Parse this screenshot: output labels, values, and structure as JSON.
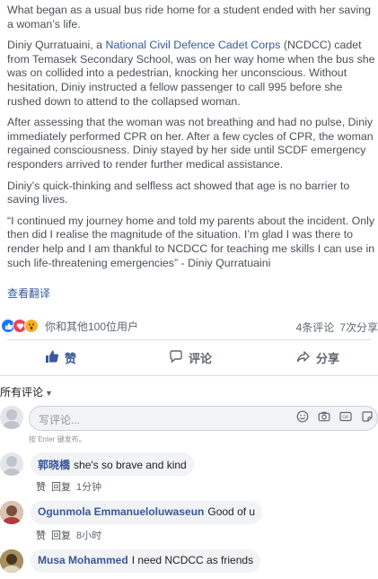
{
  "post": {
    "p1": "What began as a usual bus ride home for a student ended with her saving a woman’s life.",
    "p2_before": "Diniy Qurratuaini, a ",
    "p2_link": "National Civil Defence Cadet Corps",
    "p2_after": " (NCDCC) cadet from Temasek Secondary School, was on her way home when the bus she was on collided into a pedestrian, knocking her unconscious. Without hesitation, Diniy instructed a fellow passenger to call 995 before she rushed down to attend to the collapsed woman.",
    "p3": "After assessing that the woman was not breathing and had no pulse, Diniy immediately performed CPR on her. After a few cycles of CPR, the woman regained consciousness. Diniy stayed by her side until SCDF emergency responders arrived to render further medical assistance.",
    "p4": "Diniy’s quick-thinking and selfless act showed that age is no barrier to saving lives.",
    "p5": "“I continued my journey home and told my parents about the incident. Only then did I realise the magnitude of the situation. I’m glad I was there to render help and I am thankful to NCDCC for teaching me skills I can use in such life-threatening emergencies” - Diniy Qurratuaini",
    "translate": "查看翻译"
  },
  "reactions": {
    "summary": "你和其他100位用户",
    "comments_count": "4条评论",
    "shares_count": "7次分享"
  },
  "actions": {
    "like": "赞",
    "comment": "评论",
    "share": "分享"
  },
  "comments_section": {
    "sort_label": "所有评论",
    "input_placeholder": "写评论...",
    "hint": "按 Enter 键发布。"
  },
  "comments": [
    {
      "name": "郭晓橋",
      "text": "she's so brave and kind",
      "like": "赞",
      "reply": "回复",
      "time": "1分钟"
    },
    {
      "name": "Ogunmola Emmanueloluwaseun",
      "text": "Good of u",
      "like": "赞",
      "reply": "回复",
      "time": "8小时"
    },
    {
      "name": "Musa Mohammed",
      "text": "I need NCDCC as friends"
    }
  ],
  "colors": {
    "link": "#385898",
    "like_blue": "#1877f2",
    "love_red": "#f33e58",
    "wow_yellow": "#f7b125"
  }
}
